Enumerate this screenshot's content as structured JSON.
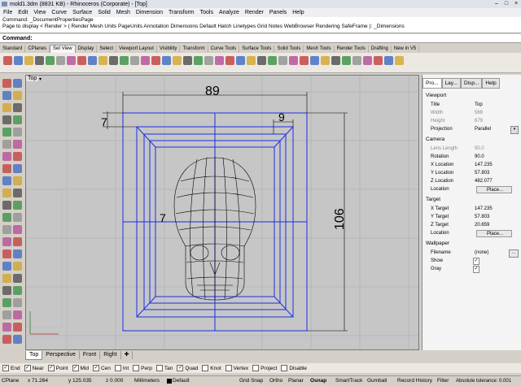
{
  "window": {
    "title": "mold1.3dm (8831 KB) - Rhinoceros (Corporate) - [Top]"
  },
  "menu": [
    "File",
    "Edit",
    "View",
    "Curve",
    "Surface",
    "Solid",
    "Mesh",
    "Dimension",
    "Transform",
    "Tools",
    "Analyze",
    "Render",
    "Panels",
    "Help"
  ],
  "command_history": [
    "Command: _DocumentPropertiesPage",
    "Page to display < Render > ( Render  Mesh  Units  PageUnits  Annotation  Dimensions  Default  Hatch  Linetypes  Grid  Notes  WebBrowser  Rendering  SafeFrame ): _Dimensions"
  ],
  "command_prompt": "Command:",
  "toolbar_tabs": [
    "Standard",
    "CPlanes",
    "Set View",
    "Display",
    "Select",
    "Viewport Layout",
    "Visibility",
    "Transform",
    "Curve Tools",
    "Surface Tools",
    "Solid Tools",
    "Mesh Tools",
    "Render Tools",
    "Drafting",
    "New in V5"
  ],
  "active_toolbar_tab": "Set View",
  "viewport": {
    "label": "Top",
    "dimensions": {
      "width": "89",
      "left_offset": "7",
      "right_offset": "9",
      "inner_left": "7",
      "height": "106"
    }
  },
  "viewport_tabs": [
    "Top",
    "Perspective",
    "Front",
    "Right"
  ],
  "panel": {
    "tabs": [
      "Pro...",
      "Lay...",
      "Disp...",
      "Help"
    ],
    "viewport_section": "Viewport",
    "viewport_rows": [
      {
        "label": "Title",
        "value": "Top",
        "disabled": false
      },
      {
        "label": "Width",
        "value": "569",
        "disabled": true
      },
      {
        "label": "Height",
        "value": "679",
        "disabled": true
      },
      {
        "label": "Projection",
        "value": "Parallel",
        "disabled": false
      }
    ],
    "camera_section": "Camera",
    "camera_rows": [
      {
        "label": "Lens Length",
        "value": "50.0",
        "disabled": true
      },
      {
        "label": "Rotation",
        "value": "90.0",
        "disabled": false
      },
      {
        "label": "X Location",
        "value": "147.235",
        "disabled": false
      },
      {
        "label": "Y Location",
        "value": "57.803",
        "disabled": false
      },
      {
        "label": "Z Location",
        "value": "482.077",
        "disabled": false
      },
      {
        "label": "Location",
        "value": "Place...",
        "disabled": false
      }
    ],
    "target_section": "Target",
    "target_rows": [
      {
        "label": "X Target",
        "value": "147.235",
        "disabled": false
      },
      {
        "label": "Y Target",
        "value": "57.803",
        "disabled": false
      },
      {
        "label": "Z Target",
        "value": "20.659",
        "disabled": false
      },
      {
        "label": "Location",
        "value": "Place...",
        "disabled": false
      }
    ],
    "wallpaper_section": "Wallpaper",
    "wallpaper_rows": [
      {
        "label": "Filename",
        "value": "(none)"
      },
      {
        "label": "Show",
        "value": "✓"
      },
      {
        "label": "Gray",
        "value": "✓"
      }
    ]
  },
  "osnaps": [
    {
      "label": "End",
      "checked": true
    },
    {
      "label": "Near",
      "checked": true
    },
    {
      "label": "Point",
      "checked": true
    },
    {
      "label": "Mid",
      "checked": true
    },
    {
      "label": "Cen",
      "checked": true
    },
    {
      "label": "Int",
      "checked": false
    },
    {
      "label": "Perp",
      "checked": false
    },
    {
      "label": "Tan",
      "checked": false
    },
    {
      "label": "Quad",
      "checked": true
    },
    {
      "label": "Knot",
      "checked": false
    },
    {
      "label": "Vertex",
      "checked": false
    },
    {
      "label": "Project",
      "checked": false
    },
    {
      "label": "Disable",
      "checked": false
    }
  ],
  "status": {
    "cplane": "CPlane",
    "x": "x 71.264",
    "y": "y 125.035",
    "z": "z 0.000",
    "units": "Millimeters",
    "layer": "Default",
    "toggles": [
      "Grid Snap",
      "Ortho",
      "Planar",
      "Osnap",
      "SmartTrack",
      "Gumball",
      "Record History",
      "Filter"
    ],
    "tolerance": "Absolute tolerance: 0.001"
  },
  "colors": {
    "geometry": "#1a2ee6",
    "viewport_bg": "#c6c6c6",
    "grid": "#a9a9a9"
  }
}
